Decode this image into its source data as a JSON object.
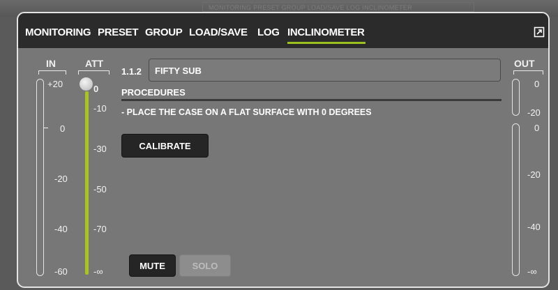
{
  "backdrop": {
    "ghost_text": "MONITORING PRESET GROUP LOAD/SAVE LOG INCLINOMETER"
  },
  "tabs": [
    {
      "label": "MONITORING",
      "active": false
    },
    {
      "label": "PRESET",
      "active": false
    },
    {
      "label": "GROUP",
      "active": false
    },
    {
      "label": "LOAD/SAVE",
      "active": false
    },
    {
      "label": "LOG",
      "active": false
    },
    {
      "label": "INCLINOMETER",
      "active": true
    }
  ],
  "header_icon": "expand-icon",
  "in_meter": {
    "label": "IN",
    "scale": [
      "+20",
      "0",
      "-20",
      "-40",
      "-60"
    ]
  },
  "att_fader": {
    "label": "ATT",
    "scale": [
      "0",
      "-10",
      "-30",
      "-50",
      "-70",
      "-∞"
    ],
    "value_db": 0
  },
  "channel": {
    "id": "1.1.2",
    "name": "FIFTY SUB"
  },
  "procedures": {
    "title": "PROCEDURES",
    "step": "- PLACE THE CASE ON A FLAT SURFACE WITH 0 DEGREES"
  },
  "buttons": {
    "calibrate": "CALIBRATE",
    "mute": "MUTE",
    "solo": "SOLO"
  },
  "out_meter": {
    "label": "OUT",
    "upper_scale": [
      "0",
      "-20"
    ],
    "lower_scale": [
      "0",
      "-20",
      "-40",
      "-∞"
    ]
  },
  "colors": {
    "accent": "#9cc11e",
    "fader_fill": "#a7c41f",
    "header_bg": "#2b2b2b",
    "panel_bg": "#777777"
  }
}
